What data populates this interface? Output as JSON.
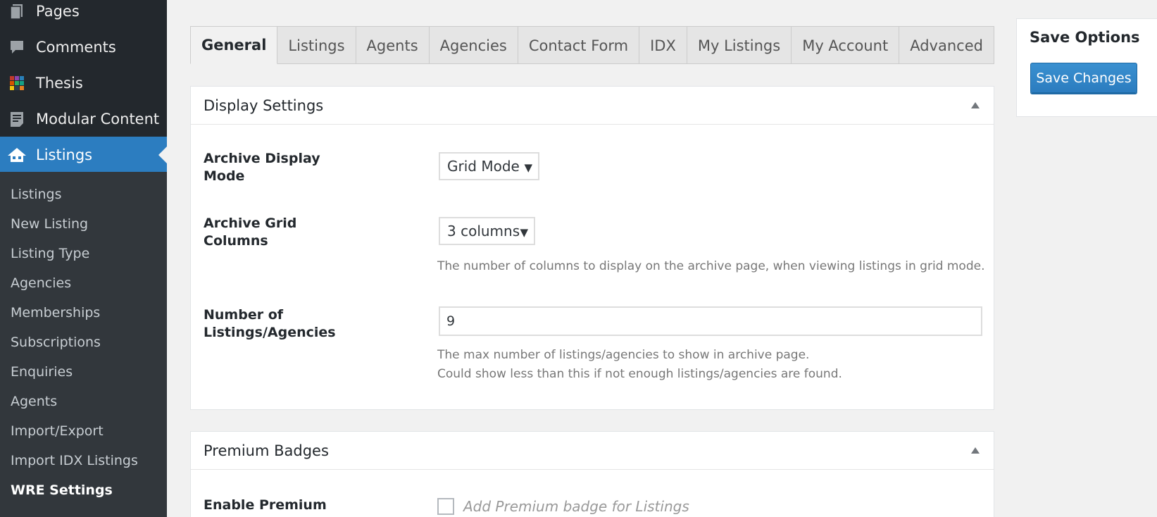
{
  "sidebar": {
    "menu": [
      {
        "label": "Pages",
        "icon": "pages-icon"
      },
      {
        "label": "Comments",
        "icon": "comments-icon"
      },
      {
        "label": "Thesis",
        "icon": "thesis-icon"
      },
      {
        "label": "Modular Content",
        "icon": "modular-content-icon"
      },
      {
        "label": "Listings",
        "icon": "listings-house-icon"
      }
    ],
    "submenu": [
      "Listings",
      "New Listing",
      "Listing Type",
      "Agencies",
      "Memberships",
      "Subscriptions",
      "Enquiries",
      "Agents",
      "Import/Export",
      "Import IDX Listings",
      "WRE Settings"
    ]
  },
  "tabs": [
    "General",
    "Listings",
    "Agents",
    "Agencies",
    "Contact Form",
    "IDX",
    "My Listings",
    "My Account",
    "Advanced"
  ],
  "display_settings": {
    "title": "Display Settings",
    "archive_mode_label": "Archive Display Mode",
    "archive_mode_value": "Grid Mode",
    "grid_columns_label": "Archive Grid Columns",
    "grid_columns_value": "3 columns",
    "grid_columns_desc": "The number of columns to display on the archive page, when viewing listings in grid mode.",
    "number_label": "Number of Listings/Agencies",
    "number_value": "9",
    "number_desc_1": "The max number of listings/agencies to show in archive page.",
    "number_desc_2": "Could show less than this if not enough listings/agencies are found."
  },
  "premium_badges": {
    "title": "Premium Badges",
    "enable_label": "Enable Premium",
    "checkbox_label": "Add Premium badge for Listings"
  },
  "save_options": {
    "title": "Save Options",
    "button": "Save Changes"
  },
  "colors": {
    "sidebar_bg": "#23282d",
    "active_menu": "#2c7dc0",
    "primary_button": "#2e86c9"
  }
}
